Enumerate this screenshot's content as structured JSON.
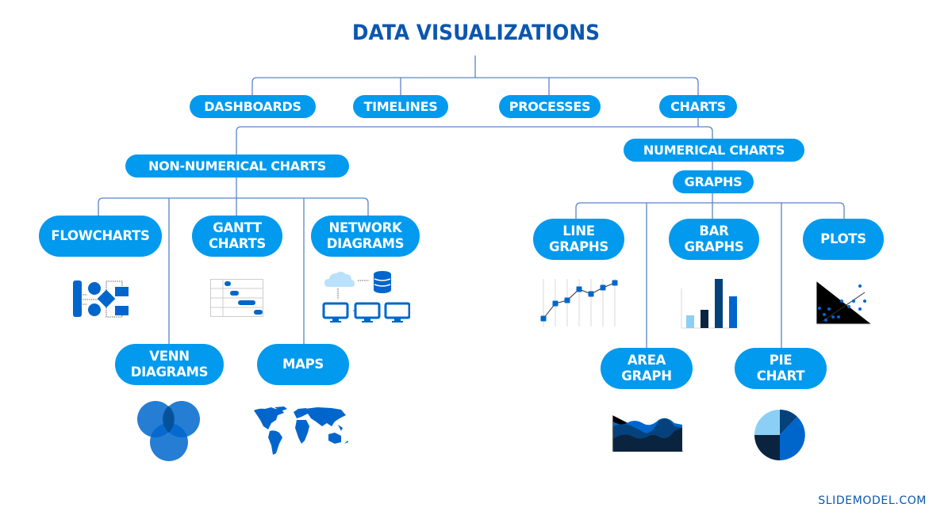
{
  "title": "DATA VISUALIZATIONS",
  "level1": {
    "dashboards": "DASHBOARDS",
    "timelines": "TIMELINES",
    "processes": "PROCESSES",
    "charts": "CHARTS"
  },
  "level2": {
    "non_numerical": "NON-NUMERICAL CHARTS",
    "numerical": "NUMERICAL CHARTS",
    "graphs": "GRAPHS"
  },
  "non_numerical_children": {
    "flowcharts": "FLOWCHARTS",
    "gantt": "GANTT\nCHARTS",
    "network": "NETWORK\nDIAGRAMS",
    "venn": "VENN\nDIAGRAMS",
    "maps": "MAPS"
  },
  "graph_children": {
    "line": "LINE\nGRAPHS",
    "bar": "BAR\nGRAPHS",
    "plots": "PLOTS",
    "area": "AREA\nGRAPH",
    "pie": "PIE\nCHART"
  },
  "icons": {
    "flowchart": "flowchart-icon",
    "gantt": "gantt-chart-icon",
    "network": "network-diagram-icon",
    "venn": "venn-diagram-icon",
    "map": "world-map-icon",
    "line": "line-graph-icon",
    "bar": "bar-graph-icon",
    "scatter": "scatter-plot-icon",
    "area": "area-graph-icon",
    "pie": "pie-chart-icon"
  },
  "colors": {
    "pill": "#019aee",
    "title": "#0b57b0",
    "connector": "#5b84c4",
    "dark_navy": "#0a2440",
    "navy": "#05427c",
    "blue": "#0066cc",
    "light_blue": "#8ccff4"
  },
  "footer": "SLIDEMODEL.COM"
}
